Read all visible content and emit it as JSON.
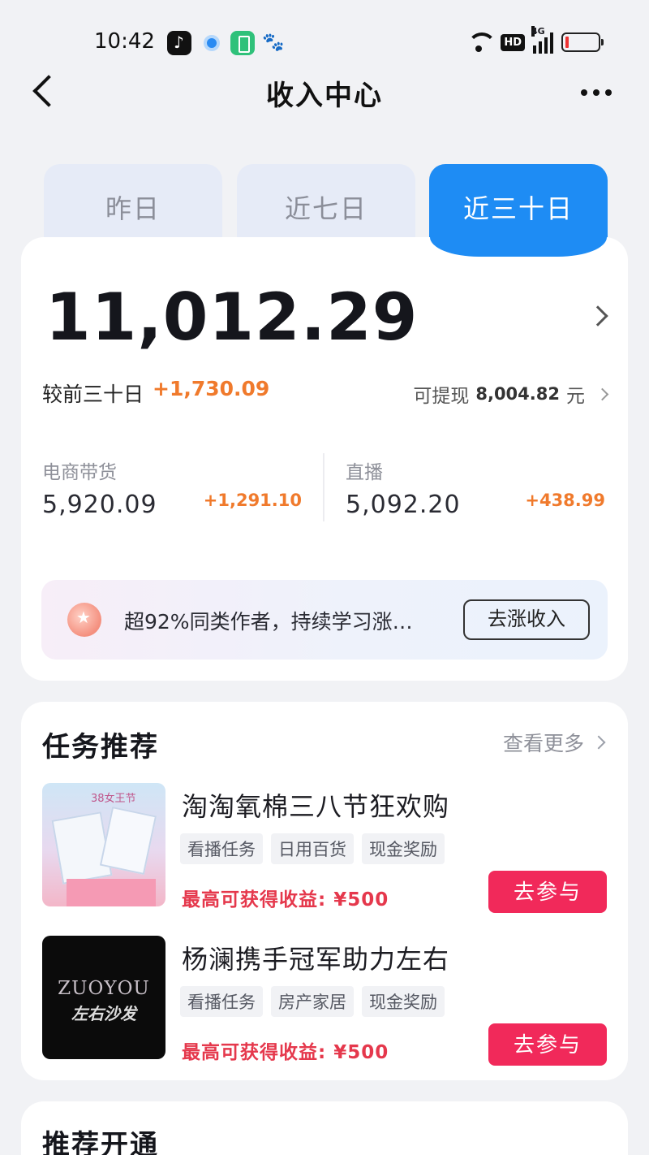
{
  "status_bar": {
    "time": "10:42",
    "icons": [
      "tiktok-icon",
      "dot-app-icon",
      "battery-app-icon",
      "baidu-icon",
      "wifi-icon",
      "hd-icon",
      "signal-4g-icon",
      "battery-icon"
    ],
    "hd_label": "HD",
    "network_label": "4G"
  },
  "nav": {
    "title": "收入中心"
  },
  "tabs": [
    {
      "label": "昨日",
      "active": false
    },
    {
      "label": "近七日",
      "active": false
    },
    {
      "label": "近三十日",
      "active": true
    }
  ],
  "earnings": {
    "total": "11,012.29",
    "compare_label": "较前三十日",
    "compare_value": "+1,730.09",
    "withdraw_label": "可提现",
    "withdraw_amount": "8,004.82",
    "withdraw_unit": "元",
    "stats": [
      {
        "label": "电商带货",
        "value": "5,920.09",
        "change": "+1,291.10"
      },
      {
        "label": "直播",
        "value": "5,092.20",
        "change": "+438.99"
      }
    ]
  },
  "promo": {
    "text": "超92%同类作者，持续学习涨…",
    "button_label": "去涨收入"
  },
  "tasks": {
    "title": "任务推荐",
    "see_more_label": "查看更多",
    "items": [
      {
        "title": "淘淘氧棉三八节狂欢购",
        "tags": [
          "看播任务",
          "日用百货",
          "现金奖励"
        ],
        "reward": "最高可获得收益: ¥500",
        "button_label": "去参与",
        "thumb_text": "38女王节"
      },
      {
        "title": "杨澜携手冠军助力左右",
        "tags": [
          "看播任务",
          "房产家居",
          "现金奖励"
        ],
        "reward": "最高可获得收益: ¥500",
        "button_label": "去参与",
        "thumb_brand": "ZUOYOU",
        "thumb_brand_cn": "左右沙发"
      }
    ]
  },
  "recommend": {
    "title": "推荐开通"
  },
  "colors": {
    "accent_blue": "#1e8cf4",
    "increase_orange": "#f07a2c",
    "reward_red": "#e5384c",
    "join_button": "#f1295a",
    "page_bg": "#f1f2f5"
  }
}
